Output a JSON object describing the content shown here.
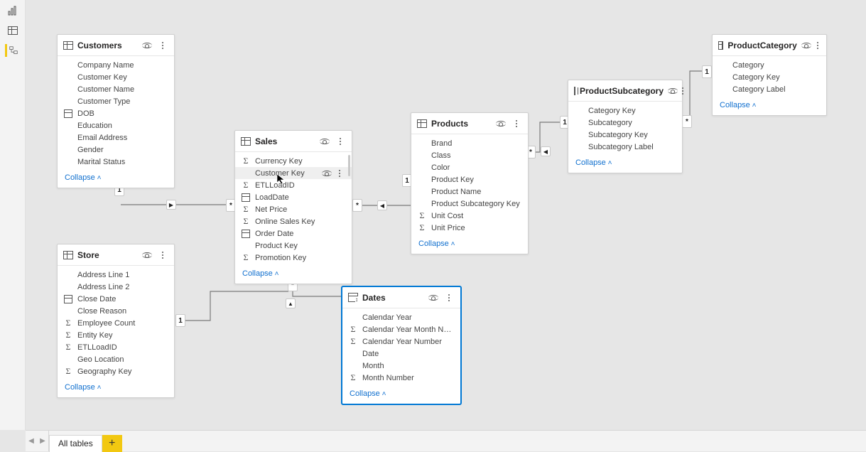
{
  "collapse_label": "Collapse",
  "bottom": {
    "all_tables": "All tables"
  },
  "endpoints": {
    "one": "1",
    "many": "*"
  },
  "tables": {
    "customers": {
      "title": "Customers",
      "fields": [
        {
          "icon": "",
          "label": "Company Name"
        },
        {
          "icon": "",
          "label": "Customer Key"
        },
        {
          "icon": "",
          "label": "Customer Name"
        },
        {
          "icon": "",
          "label": "Customer Type"
        },
        {
          "icon": "date",
          "label": "DOB"
        },
        {
          "icon": "",
          "label": "Education"
        },
        {
          "icon": "",
          "label": "Email Address"
        },
        {
          "icon": "",
          "label": "Gender"
        },
        {
          "icon": "",
          "label": "Marital Status"
        }
      ]
    },
    "store": {
      "title": "Store",
      "fields": [
        {
          "icon": "",
          "label": "Address Line 1"
        },
        {
          "icon": "",
          "label": "Address Line 2"
        },
        {
          "icon": "date",
          "label": "Close Date"
        },
        {
          "icon": "",
          "label": "Close Reason"
        },
        {
          "icon": "sigma",
          "label": "Employee Count"
        },
        {
          "icon": "sigma",
          "label": "Entity Key"
        },
        {
          "icon": "sigma",
          "label": "ETLLoadID"
        },
        {
          "icon": "",
          "label": "Geo Location"
        },
        {
          "icon": "sigma",
          "label": "Geography Key"
        }
      ]
    },
    "sales": {
      "title": "Sales",
      "fields": [
        {
          "icon": "sigma",
          "label": "Currency Key"
        },
        {
          "icon": "",
          "label": "Customer Key",
          "hl": true
        },
        {
          "icon": "sigma",
          "label": "ETLLoadID"
        },
        {
          "icon": "date",
          "label": "LoadDate"
        },
        {
          "icon": "sigma",
          "label": "Net Price"
        },
        {
          "icon": "sigma",
          "label": "Online Sales Key"
        },
        {
          "icon": "date",
          "label": "Order Date"
        },
        {
          "icon": "",
          "label": "Product Key"
        },
        {
          "icon": "sigma",
          "label": "Promotion Key"
        }
      ]
    },
    "products": {
      "title": "Products",
      "fields": [
        {
          "icon": "",
          "label": "Brand"
        },
        {
          "icon": "",
          "label": "Class"
        },
        {
          "icon": "",
          "label": "Color"
        },
        {
          "icon": "",
          "label": "Product Key"
        },
        {
          "icon": "",
          "label": "Product Name"
        },
        {
          "icon": "",
          "label": "Product Subcategory Key"
        },
        {
          "icon": "sigma",
          "label": "Unit Cost"
        },
        {
          "icon": "sigma",
          "label": "Unit Price"
        }
      ]
    },
    "productsubcategory": {
      "title": "ProductSubcategory",
      "fields": [
        {
          "icon": "",
          "label": "Category Key"
        },
        {
          "icon": "",
          "label": "Subcategory"
        },
        {
          "icon": "",
          "label": "Subcategory Key"
        },
        {
          "icon": "",
          "label": "Subcategory Label"
        }
      ]
    },
    "productcategory": {
      "title": "ProductCategory",
      "fields": [
        {
          "icon": "",
          "label": "Category"
        },
        {
          "icon": "",
          "label": "Category Key"
        },
        {
          "icon": "",
          "label": "Category Label"
        }
      ]
    },
    "dates": {
      "title": "Dates",
      "fields": [
        {
          "icon": "",
          "label": "Calendar Year"
        },
        {
          "icon": "sigma",
          "label": "Calendar Year Month Number"
        },
        {
          "icon": "sigma",
          "label": "Calendar Year Number"
        },
        {
          "icon": "",
          "label": "Date"
        },
        {
          "icon": "",
          "label": "Month"
        },
        {
          "icon": "sigma",
          "label": "Month Number"
        }
      ]
    }
  }
}
